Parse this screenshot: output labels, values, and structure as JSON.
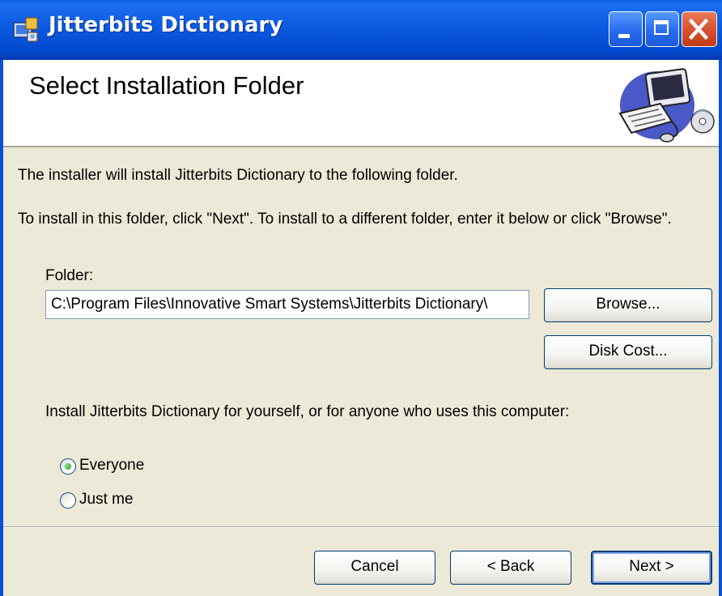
{
  "window": {
    "title": "Jitterbits Dictionary",
    "controls": [
      "minimize-icon",
      "maximize-icon",
      "close-icon"
    ]
  },
  "header": {
    "title": "Select Installation Folder",
    "art_icon": "computer-with-cd-icon"
  },
  "body": {
    "intro": "The installer will install Jitterbits Dictionary to the following folder.",
    "instructions": "To install in this folder, click \"Next\". To install to a different folder, enter it below or click \"Browse\".",
    "folder_label": "Folder:",
    "folder_value": "C:\\Program Files\\Innovative Smart Systems\\Jitterbits Dictionary\\",
    "browse_label": "Browse...",
    "disk_cost_label": "Disk Cost...",
    "scope_question": "Install Jitterbits Dictionary for yourself, or for anyone who uses this computer:",
    "options": [
      {
        "label": "Everyone",
        "selected": true
      },
      {
        "label": "Just me",
        "selected": false
      }
    ]
  },
  "footer": {
    "cancel_label": "Cancel",
    "back_label": "< Back",
    "next_label": "Next >"
  },
  "colors": {
    "titlebar": "#0a5fe0",
    "dialog_bg": "#ece9d8",
    "close_button": "#d8532f",
    "button_border": "#003c74"
  }
}
